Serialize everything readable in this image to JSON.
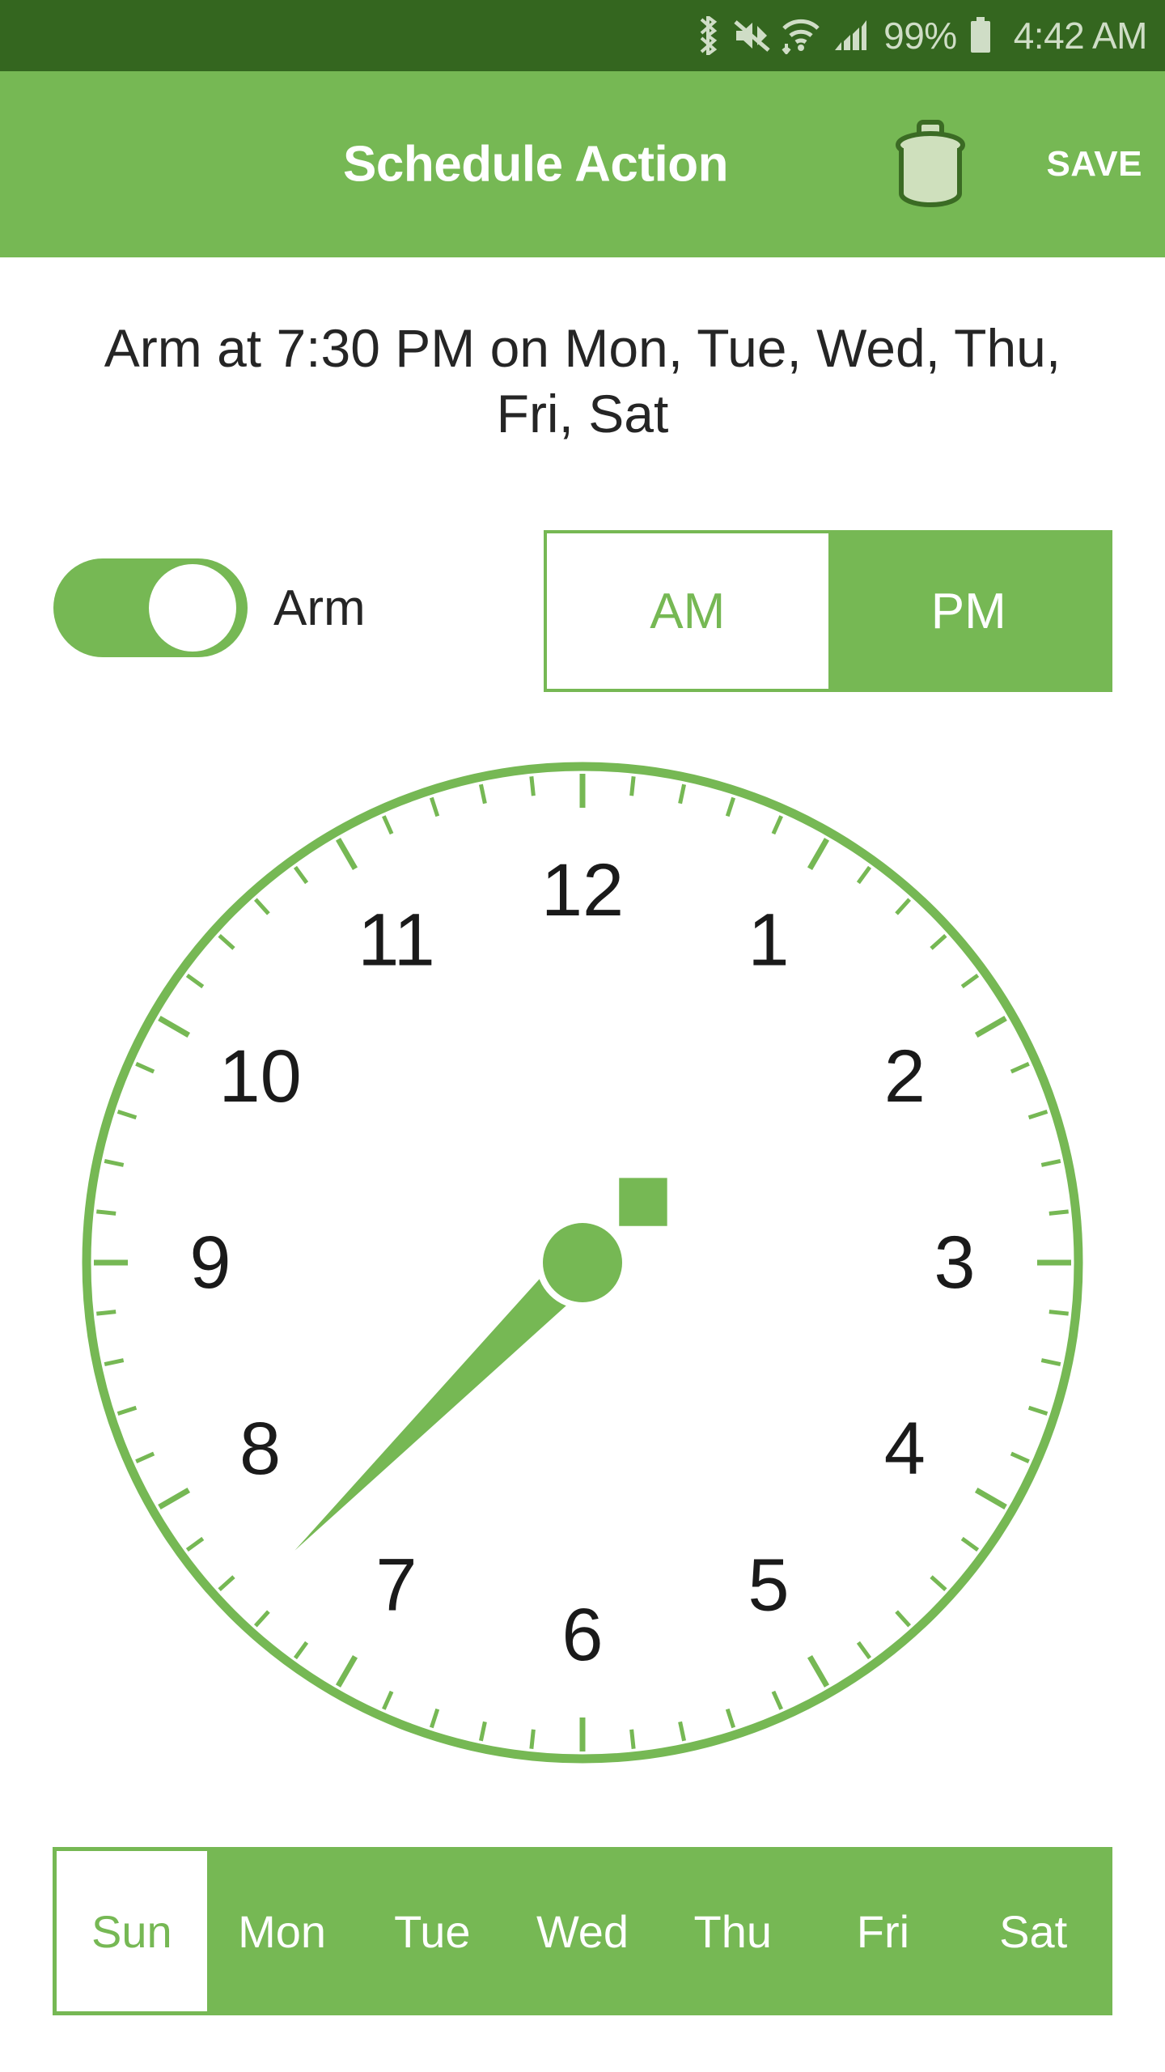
{
  "status_bar": {
    "background": "#34661f",
    "foreground": "#cfddc6",
    "icons": [
      "bluetooth-icon",
      "mute-icon",
      "wifi-icon",
      "signal-icon",
      "battery-icon"
    ],
    "battery_percent": "99%",
    "time": "4:42 AM"
  },
  "app_bar": {
    "background": "#76b854",
    "title": "Schedule Action",
    "delete_icon": "trash-icon",
    "save_label": "SAVE"
  },
  "summary": {
    "text": "Arm at 7:30 PM on Mon, Tue, Wed, Thu, Fri, Sat"
  },
  "arm_toggle": {
    "label": "Arm",
    "state": "on",
    "accent": "#76b854"
  },
  "meridiem": {
    "options": [
      {
        "label": "AM",
        "selected": false
      },
      {
        "label": "PM",
        "selected": true
      }
    ],
    "selected": "PM"
  },
  "clock": {
    "hour": 7,
    "minute": 30,
    "meridiem": "PM",
    "hand_angle_deg": 225,
    "numerals": [
      "12",
      "1",
      "2",
      "3",
      "4",
      "5",
      "6",
      "7",
      "8",
      "9",
      "10",
      "11"
    ],
    "face_color": "#ffffff",
    "rim_color": "#76b854",
    "tick_color": "#76b854",
    "hand_color": "#76b854",
    "numeral_color": "#1a1a1a"
  },
  "days": {
    "items": [
      {
        "label": "Sun",
        "selected": false
      },
      {
        "label": "Mon",
        "selected": true
      },
      {
        "label": "Tue",
        "selected": true
      },
      {
        "label": "Wed",
        "selected": true
      },
      {
        "label": "Thu",
        "selected": true
      },
      {
        "label": "Fri",
        "selected": true
      },
      {
        "label": "Sat",
        "selected": true
      }
    ],
    "accent": "#76b854"
  }
}
